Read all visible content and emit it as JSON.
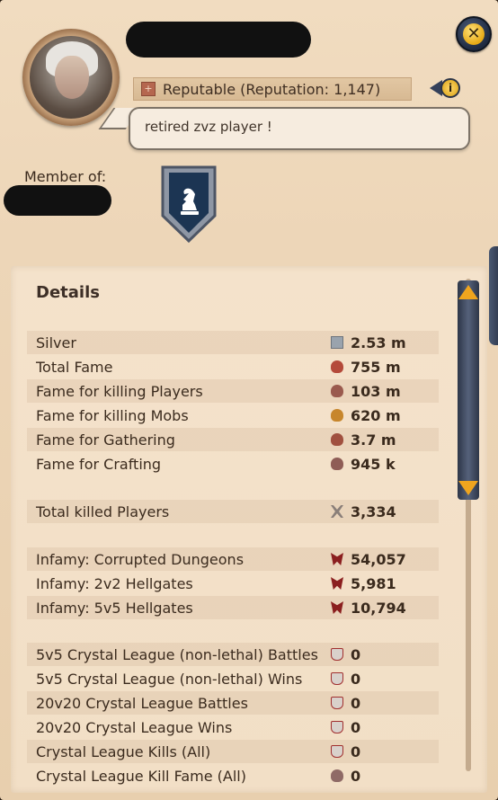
{
  "window": {
    "close_icon": "close-icon",
    "accent": "#e6a915"
  },
  "profile": {
    "reputation_text": "Reputable (Reputation: 1,147)",
    "info_icon": "info-icon",
    "motto": "retired zvz player !",
    "member_of_label": "Member of:",
    "guild_icon": "knight-chess-shield-icon"
  },
  "details": {
    "title": "Details",
    "rows": [
      {
        "label": "Silver",
        "value": "2.53 m",
        "icon": "silver-icon"
      },
      {
        "label": "Total Fame",
        "value": "755 m",
        "icon": "fame-icon"
      },
      {
        "label": "Fame for killing Players",
        "value": "103 m",
        "icon": "pvp-fame-icon"
      },
      {
        "label": "Fame for killing Mobs",
        "value": "620 m",
        "icon": "pve-fame-icon"
      },
      {
        "label": "Fame for Gathering",
        "value": "3.7 m",
        "icon": "gathering-fame-icon"
      },
      {
        "label": "Fame for Crafting",
        "value": "945 k",
        "icon": "crafting-fame-icon"
      },
      {
        "label": "Total killed Players",
        "value": "3,334",
        "icon": "crossed-swords-icon"
      },
      {
        "label": "Infamy: Corrupted Dungeons",
        "value": "54,057",
        "icon": "infamy-icon"
      },
      {
        "label": "Infamy: 2v2 Hellgates",
        "value": "5,981",
        "icon": "infamy-icon"
      },
      {
        "label": "Infamy: 5v5 Hellgates",
        "value": "10,794",
        "icon": "infamy-icon"
      },
      {
        "label": "5v5 Crystal League (non-lethal) Battles",
        "value": "0",
        "icon": "crystal-league-icon"
      },
      {
        "label": "5v5 Crystal League (non-lethal) Wins",
        "value": "0",
        "icon": "crystal-league-icon"
      },
      {
        "label": "20v20 Crystal League Battles",
        "value": "0",
        "icon": "crystal-league-icon"
      },
      {
        "label": "20v20 Crystal League Wins",
        "value": "0",
        "icon": "crystal-league-icon"
      },
      {
        "label": "Crystal League Kills (All)",
        "value": "0",
        "icon": "crystal-league-icon"
      },
      {
        "label": "Crystal League Kill Fame (All)",
        "value": "0",
        "icon": "crystal-fame-icon"
      }
    ]
  }
}
